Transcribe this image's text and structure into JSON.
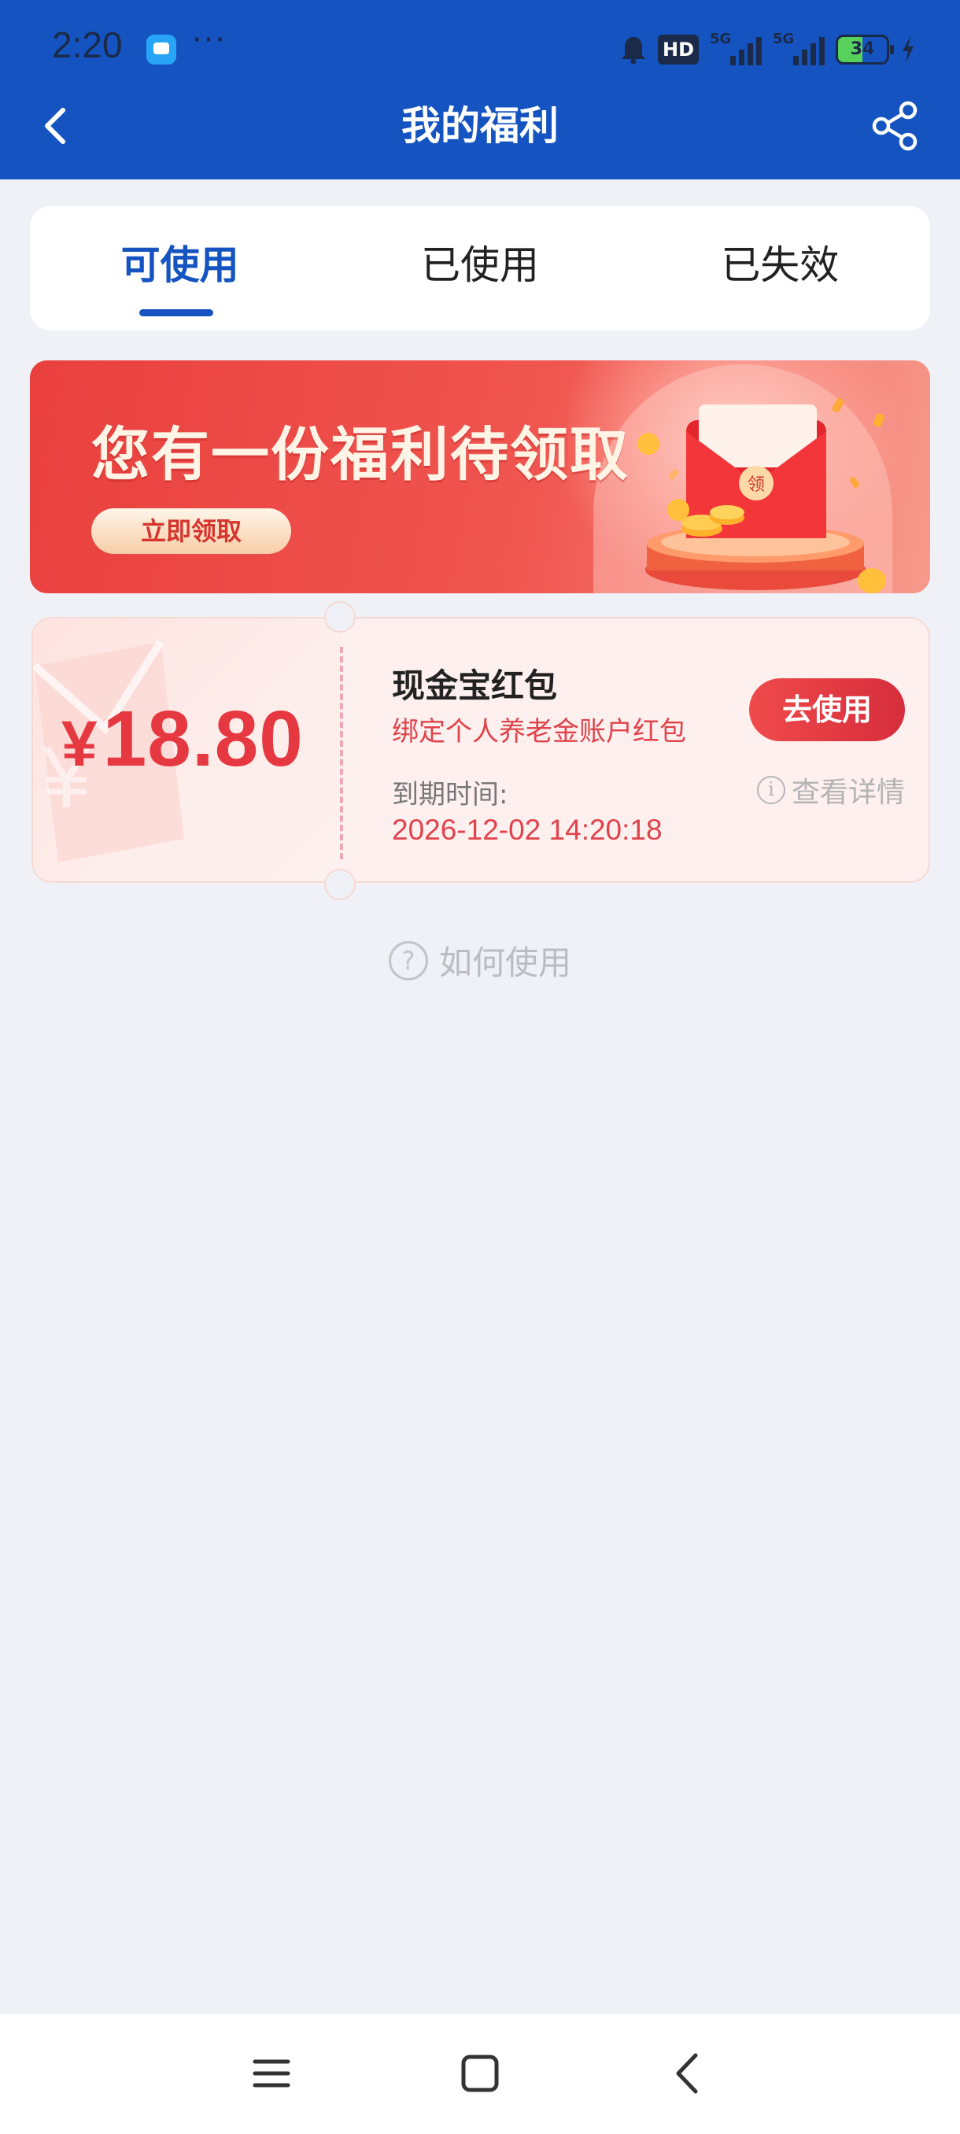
{
  "status_bar": {
    "time": "2:20",
    "more": "···",
    "hd_label": "HD",
    "sim1_label": "5G",
    "sim2_label": "5G",
    "battery_level": "34"
  },
  "nav": {
    "title": "我的福利",
    "back_icon": "chevron-left-icon",
    "share_icon": "share-icon"
  },
  "tabs": [
    {
      "label": "可使用",
      "active": true
    },
    {
      "label": "已使用",
      "active": false
    },
    {
      "label": "已失效",
      "active": false
    }
  ],
  "banner": {
    "title": "您有一份福利待领取",
    "button_label": "立即领取",
    "envelope_text": "领"
  },
  "coupon": {
    "currency": "¥",
    "amount": "18.80",
    "name": "现金宝红包",
    "description": "绑定个人养老金账户红包",
    "expiry_label": "到期时间:",
    "expiry_value": "2026-12-02 14:20:18",
    "use_button": "去使用",
    "details_link": "查看详情"
  },
  "howto": {
    "label": "如何使用"
  },
  "colors": {
    "brand_blue": "#1554c0",
    "accent_red": "#e63840",
    "background": "#eff1f7"
  }
}
